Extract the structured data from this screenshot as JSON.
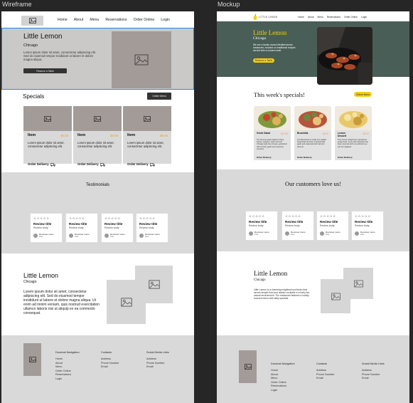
{
  "frames": {
    "wireframe_label": "Wireframe",
    "mockup_label": "Mockup"
  },
  "nav": {
    "items": [
      "Home",
      "About",
      "Menu",
      "Reservations",
      "Order Online",
      "Login"
    ],
    "mockup_items": [
      "Home",
      "About",
      "Menu",
      "Reservations",
      "Order Online",
      "Login"
    ],
    "logo_text": "LITTLE LEMON"
  },
  "hero": {
    "title": "Little Lemon",
    "subtitle": "Chicago",
    "body": "Lorem ipsum dolor sit amet, consectetur adipiscing elit. Sed do eiusmod tempor incididunt ut labore et dolore magna aliqua.",
    "button": "Reserve a Table",
    "mockup_body": "We are a family owned Mediterranean restaurant, focused on traditional recipes served with a modern twist.",
    "mockup_button": "Reserve a Table"
  },
  "specials": {
    "title": "Specials",
    "button": "Online Menu",
    "mockup_title": "This week's specials!",
    "mockup_button": "Online Menu",
    "items": [
      {
        "name": "Item",
        "price": "$0.00",
        "desc": "Lorem ipsum dolor sit amet, consectetur adipiscing elit.",
        "delivery": "Order Delivery"
      },
      {
        "name": "Item",
        "price": "$0.00",
        "desc": "Lorem ipsum dolor sit amet, consectetur adipiscing elit.",
        "delivery": "Order Delivery"
      },
      {
        "name": "Item",
        "price": "$0.00",
        "desc": "Lorem ipsum dolor sit amet, consectetur adipiscing elit.",
        "delivery": "Order Delivery"
      }
    ],
    "mockup_items": [
      {
        "name": "Greek Salad",
        "price": "$12.99",
        "desc": "The famous greek salad of crispy lettuce, peppers, olives and our Chicago style feta cheese, garnished with crunchy garlic and rosemary croutons.",
        "delivery": "Order Delivery"
      },
      {
        "name": "Bruchetta",
        "price": "$5.99",
        "desc": "Our Bruschetta is made from grilled bread that has been smeared with garlic and seasoned with salt and olive oil.",
        "delivery": "Order Delivery"
      },
      {
        "name": "Lemon Dessert",
        "price": "$5.00",
        "desc": "This comes straight from grandma's recipe book, every last ingredient has been sourced and is as authentic as can be imagined.",
        "delivery": "Order Delivery"
      }
    ]
  },
  "testimonials": {
    "title": "Testimonials",
    "mockup_title": "Our customers love us!",
    "stars": "☆☆☆☆☆",
    "reviews": [
      {
        "title": "Review title",
        "body": "Review body",
        "name": "Reviewer name",
        "date": "Date"
      },
      {
        "title": "Review title",
        "body": "Review body",
        "name": "Reviewer name",
        "date": "Date"
      },
      {
        "title": "Review title",
        "body": "Review body",
        "name": "Reviewer name",
        "date": "Date"
      },
      {
        "title": "Review title",
        "body": "Review body",
        "name": "Reviewer name",
        "date": "Date"
      }
    ]
  },
  "about": {
    "title": "Little Lemon",
    "subtitle": "Chicago",
    "body": "Lorem ipsum dolor sit amet, consectetur adipiscing elit. Sed do eiusmod tempor incididunt ut labore et dolore magna aliqua. Ut enim ad minim veniam, quis nostrud exercitation ullamco laboris nisi ut aliquip ex ea commodo consequat.",
    "mockup_body": "Little Lemon is a charming neighborhood bistro that serves simple food and classic cocktails in a lively but casual environment. The restaurant features a locally-sourced menu with daily specials."
  },
  "footer": {
    "columns": [
      {
        "title": "Doormat Navigation",
        "items": [
          "Home",
          "About",
          "Menu",
          "Order Online",
          "Reservations",
          "Login"
        ]
      },
      {
        "title": "Contacts",
        "items": [
          "Address",
          "Phone Number",
          "Email"
        ]
      },
      {
        "title": "Social Media Links",
        "items": [
          "Address",
          "Phone Number",
          "Email"
        ]
      }
    ]
  },
  "colors": {
    "accent": "#f4ce14",
    "green": "#495e57",
    "selection": "#1e88e5",
    "placeholder": "#a39b98"
  }
}
